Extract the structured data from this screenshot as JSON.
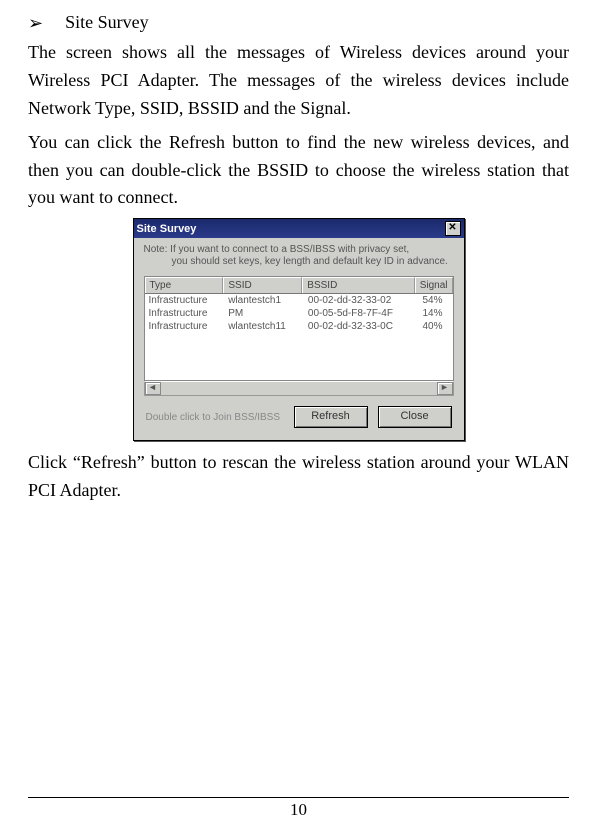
{
  "bullet": {
    "marker": "➢",
    "title": "Site Survey"
  },
  "paragraphs": {
    "p1": "The screen shows all the messages of Wireless devices around your Wireless PCI Adapter. The messages of the wireless devices include Network Type, SSID, BSSID and the Signal.",
    "p2": "You can click the Refresh button to find the new wireless devices, and then you can double-click the BSSID to choose the wireless station that you want to connect.",
    "p3": "Click “Refresh” button to rescan the wireless station around your WLAN PCI Adapter."
  },
  "dialog": {
    "title": "Site Survey",
    "note_l1": "Note: If you want to connect to a BSS/IBSS with privacy set,",
    "note_l2": "you should set keys, key length and default key ID in advance.",
    "headers": {
      "type": "Type",
      "ssid": "SSID",
      "bssid": "BSSID",
      "signal": "Signal"
    },
    "rows": [
      {
        "type": "Infrastructure",
        "ssid": "wlantestch1",
        "bssid": "00-02-dd-32-33-02",
        "signal": "54%"
      },
      {
        "type": "Infrastructure",
        "ssid": "PM",
        "bssid": "00-05-5d-F8-7F-4F",
        "signal": "14%"
      },
      {
        "type": "Infrastructure",
        "ssid": "wlantestch11",
        "bssid": "00-02-dd-32-33-0C",
        "signal": "40%"
      }
    ],
    "hint": "Double click to Join BSS/IBSS",
    "refresh": "Refresh",
    "close": "Close",
    "x": "✕",
    "left": "◄",
    "right": "►"
  },
  "page_number": "10"
}
